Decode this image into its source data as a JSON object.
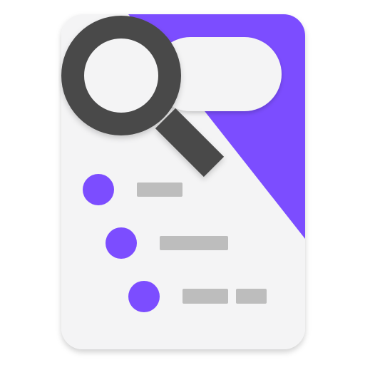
{
  "icon": {
    "name": "document-search-app-icon",
    "colors": {
      "page": "#f4f4f5",
      "accent": "#7c4dff",
      "search_pill": "#f4f4f5",
      "bullet": "#7c4dff",
      "text_line": "#bdbdbd",
      "magnifier": "#4a4a4a",
      "lens": "#f4f4f5"
    },
    "list": {
      "rows": [
        {
          "bullet": "dot",
          "lines": 1
        },
        {
          "bullet": "dot",
          "lines": 1
        },
        {
          "bullet": "dot",
          "lines": 2
        }
      ]
    }
  }
}
